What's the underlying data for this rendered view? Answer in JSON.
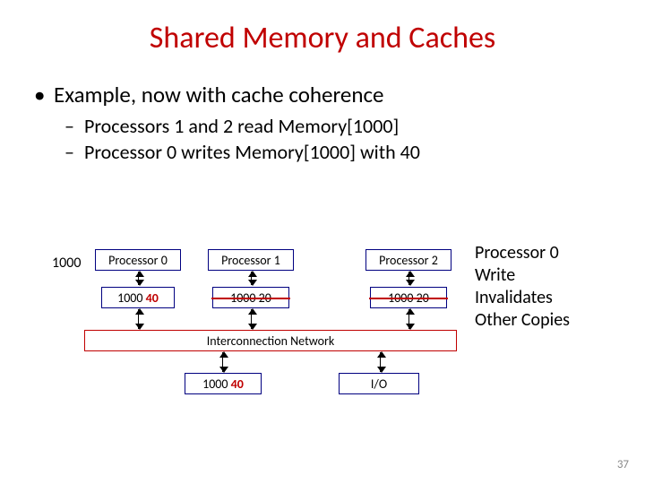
{
  "title": "Shared Memory and Caches",
  "bullets": {
    "lvl1": "Example, now with cache coherence",
    "lvl2a": "Processors 1 and 2 read Memory[1000]",
    "lvl2b": "Processor 0 writes Memory[1000] with 40"
  },
  "side_addr": "1000",
  "side_note": {
    "l1": "Processor 0",
    "l2": "Write",
    "l3": "Invalidates",
    "l4": "Other Copies"
  },
  "processors": [
    {
      "label_prefix": "Processor",
      "label_num": "0",
      "cache_addr": "1000",
      "cache_val": "40",
      "val_class": "val40"
    },
    {
      "label_prefix": "Processor",
      "label_num": "1",
      "cache_addr": "1000",
      "cache_val": "20",
      "val_class": "val20"
    },
    {
      "label_prefix": "Processor",
      "label_num": "2",
      "cache_addr": "1000",
      "cache_val": "20",
      "val_class": "val20"
    }
  ],
  "interconnect_label": "Interconnection Network",
  "memory": {
    "addr": "1000",
    "val": "40"
  },
  "io_label": "I/O",
  "page_number": "37",
  "colors": {
    "title": "#c00000",
    "box_border": "#000080",
    "highlight": "#c00000"
  }
}
